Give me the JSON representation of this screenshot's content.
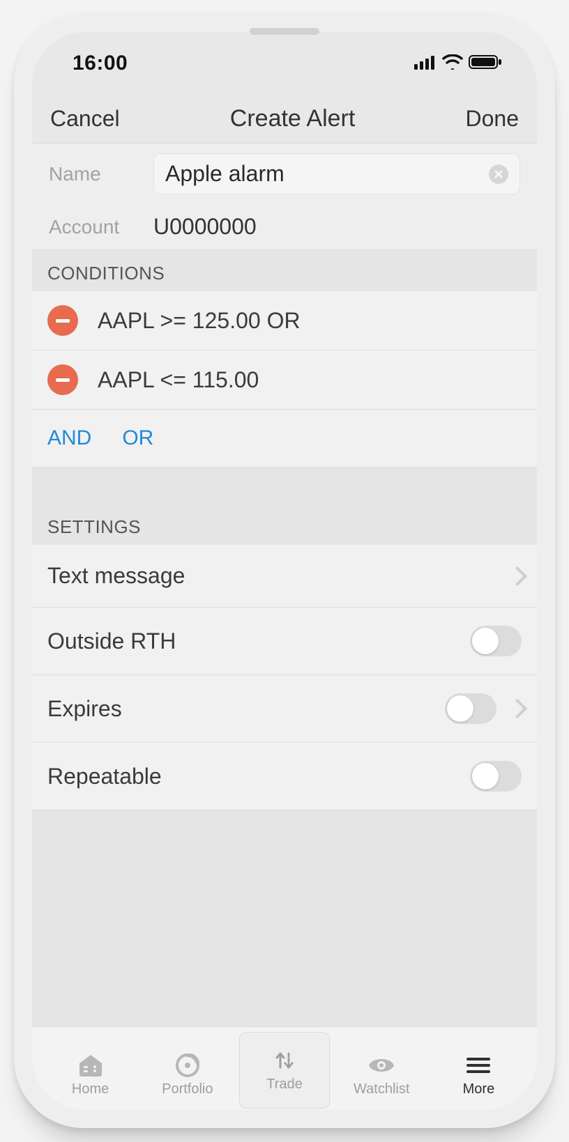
{
  "status": {
    "time": "16:00"
  },
  "nav": {
    "cancel": "Cancel",
    "title": "Create Alert",
    "done": "Done"
  },
  "form": {
    "name_label": "Name",
    "name_value": "Apple alarm",
    "account_label": "Account",
    "account_value": "U0000000"
  },
  "sections": {
    "conditions_header": "CONDITIONS",
    "settings_header": "SETTINGS"
  },
  "conditions": [
    {
      "text": "AAPL >= 125.00 OR"
    },
    {
      "text": "AAPL <= 115.00"
    }
  ],
  "logic": {
    "and": "AND",
    "or": "OR"
  },
  "settings": {
    "text_message": "Text message",
    "outside_rth": "Outside RTH",
    "expires": "Expires",
    "repeatable": "Repeatable"
  },
  "tabs": {
    "home": "Home",
    "portfolio": "Portfolio",
    "trade": "Trade",
    "watchlist": "Watchlist",
    "more": "More"
  }
}
